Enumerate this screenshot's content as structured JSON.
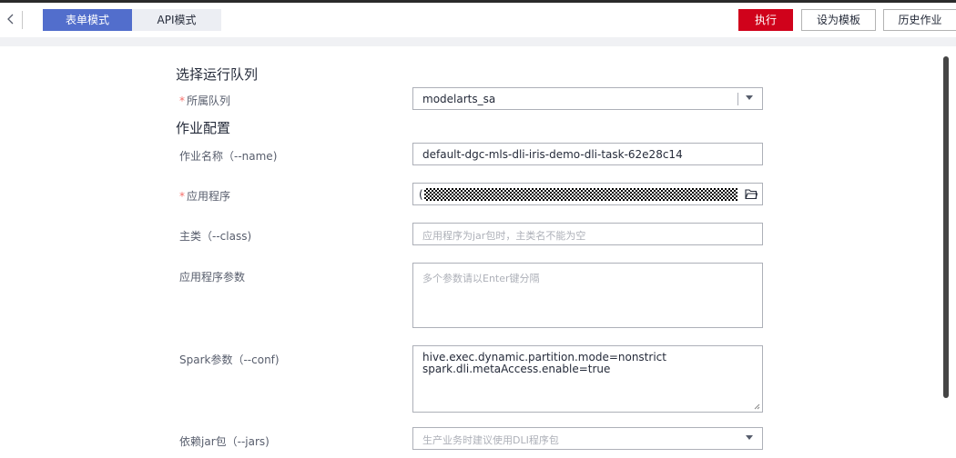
{
  "toolbar": {
    "tabs": {
      "form_mode": "表单模式",
      "api_mode": "API模式"
    },
    "buttons": {
      "execute": "执行",
      "set_template": "设为模板",
      "history": "历史作业"
    }
  },
  "sections": {
    "queue": "选择运行队列",
    "job_config": "作业配置"
  },
  "form": {
    "queue": {
      "label": "所属队列",
      "required_mark": "*",
      "value": "modelarts_sa"
    },
    "job_name": {
      "label": "作业名称（--name)",
      "value": "default-dgc-mls-dli-iris-demo-dli-task-62e28c14"
    },
    "application": {
      "label": "应用程序",
      "required_mark": "*",
      "value": "("
    },
    "main_class": {
      "label": "主类（--class)",
      "placeholder": "应用程序为jar包时，主类名不能为空"
    },
    "app_params": {
      "label": "应用程序参数",
      "placeholder": "多个参数请以Enter键分隔"
    },
    "spark_params": {
      "label": "Spark参数（--conf)",
      "lines": [
        "hive.exec.dynamic.partition.mode=nonstrict",
        "spark.dli.metaAccess.enable=true"
      ]
    },
    "jars": {
      "label": "依赖jar包（--jars)",
      "placeholder": "生产业务时建议使用DLI程序包"
    }
  },
  "colors": {
    "accent": "#526ecc",
    "danger": "#d0021b",
    "required": "#f66f6a"
  }
}
